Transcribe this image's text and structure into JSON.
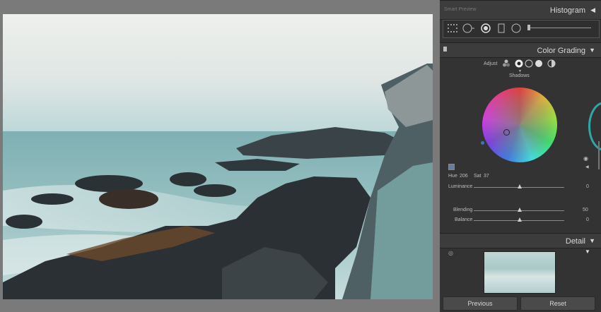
{
  "toolstrip": {
    "label": "Smart Preview"
  },
  "histogram": {
    "title": "Histogram"
  },
  "color_grading": {
    "title": "Color Grading",
    "adjust_label": "Adjust",
    "mode_label": "Shadows",
    "hue_label": "Hue",
    "hue_value": "206",
    "sat_label": "Sat",
    "sat_value": "37",
    "luminance_label": "Luminance",
    "luminance_value": "0",
    "blending_label": "Blending",
    "blending_value": "50",
    "balance_label": "Balance",
    "balance_value": "0"
  },
  "detail": {
    "title": "Detail"
  },
  "buttons": {
    "previous": "Previous",
    "reset": "Reset"
  },
  "colors": {
    "panel_bg": "#333333",
    "header_bg": "#3c3c3c",
    "canvas_bg": "#7a7a7a"
  }
}
